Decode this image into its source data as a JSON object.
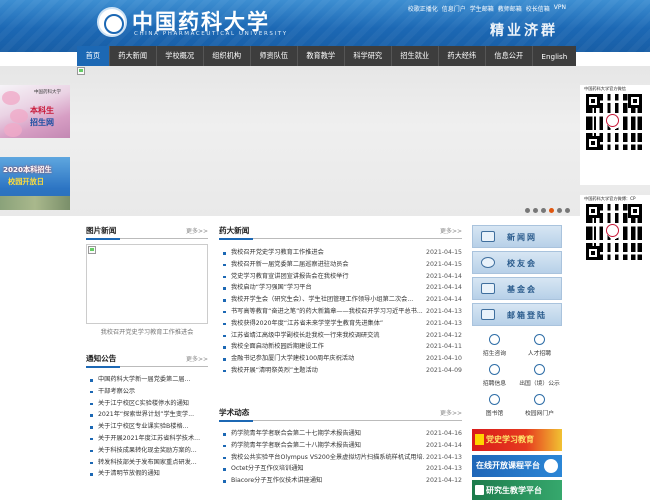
{
  "header": {
    "logo_cn": "中国药科大学",
    "logo_en": "CHINA PHARMACEUTICAL UNIVERSITY",
    "motto": "精业济群",
    "top_links": [
      "校歌正播化",
      "信息门户",
      "学生邮箱",
      "教师邮箱",
      "校长信箱",
      "VPN"
    ]
  },
  "nav": {
    "items": [
      "首页",
      "药大新闻",
      "学校概况",
      "组织机构",
      "师资队伍",
      "教育教学",
      "科学研究",
      "招生就业",
      "药大经纬",
      "信息公开",
      "English"
    ]
  },
  "banner": {
    "slide_count": 6,
    "active_slide": 3
  },
  "ads": {
    "left1": {
      "crest": "中国药科大学",
      "line1": "本科生",
      "line2": "招生网"
    },
    "left2": {
      "line1": "2020本科招生",
      "line2": "校园开放日"
    }
  },
  "qr": {
    "qr1_caption": "中国药科大学官方微信",
    "qr2_caption": "中国药科大学官方微博：CP"
  },
  "pics": {
    "title": "图片新闻",
    "more": "更多>>",
    "caption": "我校召开党史学习教育工作推进会"
  },
  "notice": {
    "title": "通知公告",
    "more": "更多>>",
    "items": [
      "中国药科大学新一届党委第二届...",
      "干部考察公示",
      "关于江宁校区C实验楼停水的通知",
      "2021年“探索世界计划”学生变学...",
      "关于江宁校区专业课实验B楼格...",
      "关于开展2021年度江苏省科学技术...",
      "关于科技成果转化现金奖励方案的...",
      "转发科技部关于发布国家重点研发...",
      "关于清明节放假的通知"
    ]
  },
  "news": {
    "title": "药大新闻",
    "more": "更多>>",
    "items": [
      {
        "text": "我校召开党史学习教育工作推进会",
        "date": "2021-04-15"
      },
      {
        "text": "我校召开新一届党委第二届巡察进驻动员会",
        "date": "2021-04-15"
      },
      {
        "text": "党史学习教育宣讲团宣讲报告会在我校举行",
        "date": "2021-04-14"
      },
      {
        "text": "我校启动“学习强国”学习平台",
        "date": "2021-04-14"
      },
      {
        "text": "我校开学生会（研究生会）、学生社团管理工作领导小组第二次会...",
        "date": "2021-04-14"
      },
      {
        "text": "书写高等教育“奋进之笔”的药大新篇章——我校召开学习习近平总书...",
        "date": "2021-04-13"
      },
      {
        "text": "我校获得2020年度“江苏省未来学堂学生教育先进集体”",
        "date": "2021-04-13"
      },
      {
        "text": "江苏省靖江高级中学副校长赴我校一行来我校调研交流",
        "date": "2021-04-12"
      },
      {
        "text": "我校全面启动新校园后期建设工作",
        "date": "2021-04-11"
      },
      {
        "text": "金融书记参加厦门大学建校100周年庆祝活动",
        "date": "2021-04-10"
      },
      {
        "text": "我校开展“清明祭英烈”主题活动",
        "date": "2021-04-09"
      }
    ]
  },
  "academic": {
    "title": "学术动态",
    "more": "更多>>",
    "items": [
      {
        "text": "药学院青年学者联合会第二十七期学术报告通知",
        "date": "2021-04-16"
      },
      {
        "text": "药学院青年学者联合会第二十八期学术报告通知",
        "date": "2021-04-14"
      },
      {
        "text": "我校公共实验平台Olympus VS200全景虚拟切片扫描系统样机试用培...",
        "date": "2021-04-13"
      },
      {
        "text": "Octet分子互作仪培训通知",
        "date": "2021-04-13"
      },
      {
        "text": "Biacore分子互作仪技术讲座通知",
        "date": "2021-04-12"
      }
    ]
  },
  "right": {
    "buttons": [
      "新闻网",
      "校友会",
      "基金会",
      "邮箱登陆"
    ],
    "icons": [
      {
        "icon": "handshake-icon",
        "label": "招生咨询"
      },
      {
        "icon": "people-icon",
        "label": "人才招聘"
      },
      {
        "icon": "info-icon",
        "label": "招聘信息"
      },
      {
        "icon": "globe-icon",
        "label": "出国（境）公示"
      },
      {
        "icon": "library-icon",
        "label": "图书馆"
      },
      {
        "icon": "network-icon",
        "label": "校园网门户"
      }
    ],
    "promo1": "党史学习教育",
    "promo2": "在线开放课程平台",
    "promo3": "研究生教学平台"
  }
}
